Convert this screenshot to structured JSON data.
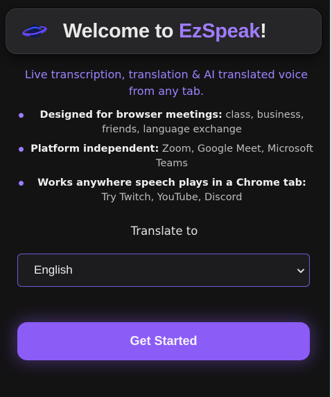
{
  "header": {
    "title_prefix": "Welcome to ",
    "title_brand": "EzSpeak",
    "title_suffix": "!"
  },
  "subtitle": "Live transcription, translation & AI translated voice from any tab.",
  "features": [
    {
      "bold": "Designed for browser meetings:",
      "text": " class, business, friends, language exchange"
    },
    {
      "bold": "Platform independent:",
      "text": " Zoom, Google Meet, Microsoft Teams"
    },
    {
      "bold": "Works anywhere speech plays in a Chrome tab:",
      "text": " Try Twitch, YouTube, Discord"
    }
  ],
  "translate": {
    "label": "Translate to",
    "selected": "English"
  },
  "cta": {
    "label": "Get Started"
  },
  "colors": {
    "accent": "#8b5cf6",
    "brand_text": "#a07dff",
    "subtitle": "#9f83ff",
    "background": "#141314"
  },
  "icons": {
    "logo": "planet-logo-icon",
    "select_arrow": "chevron-down-icon"
  }
}
